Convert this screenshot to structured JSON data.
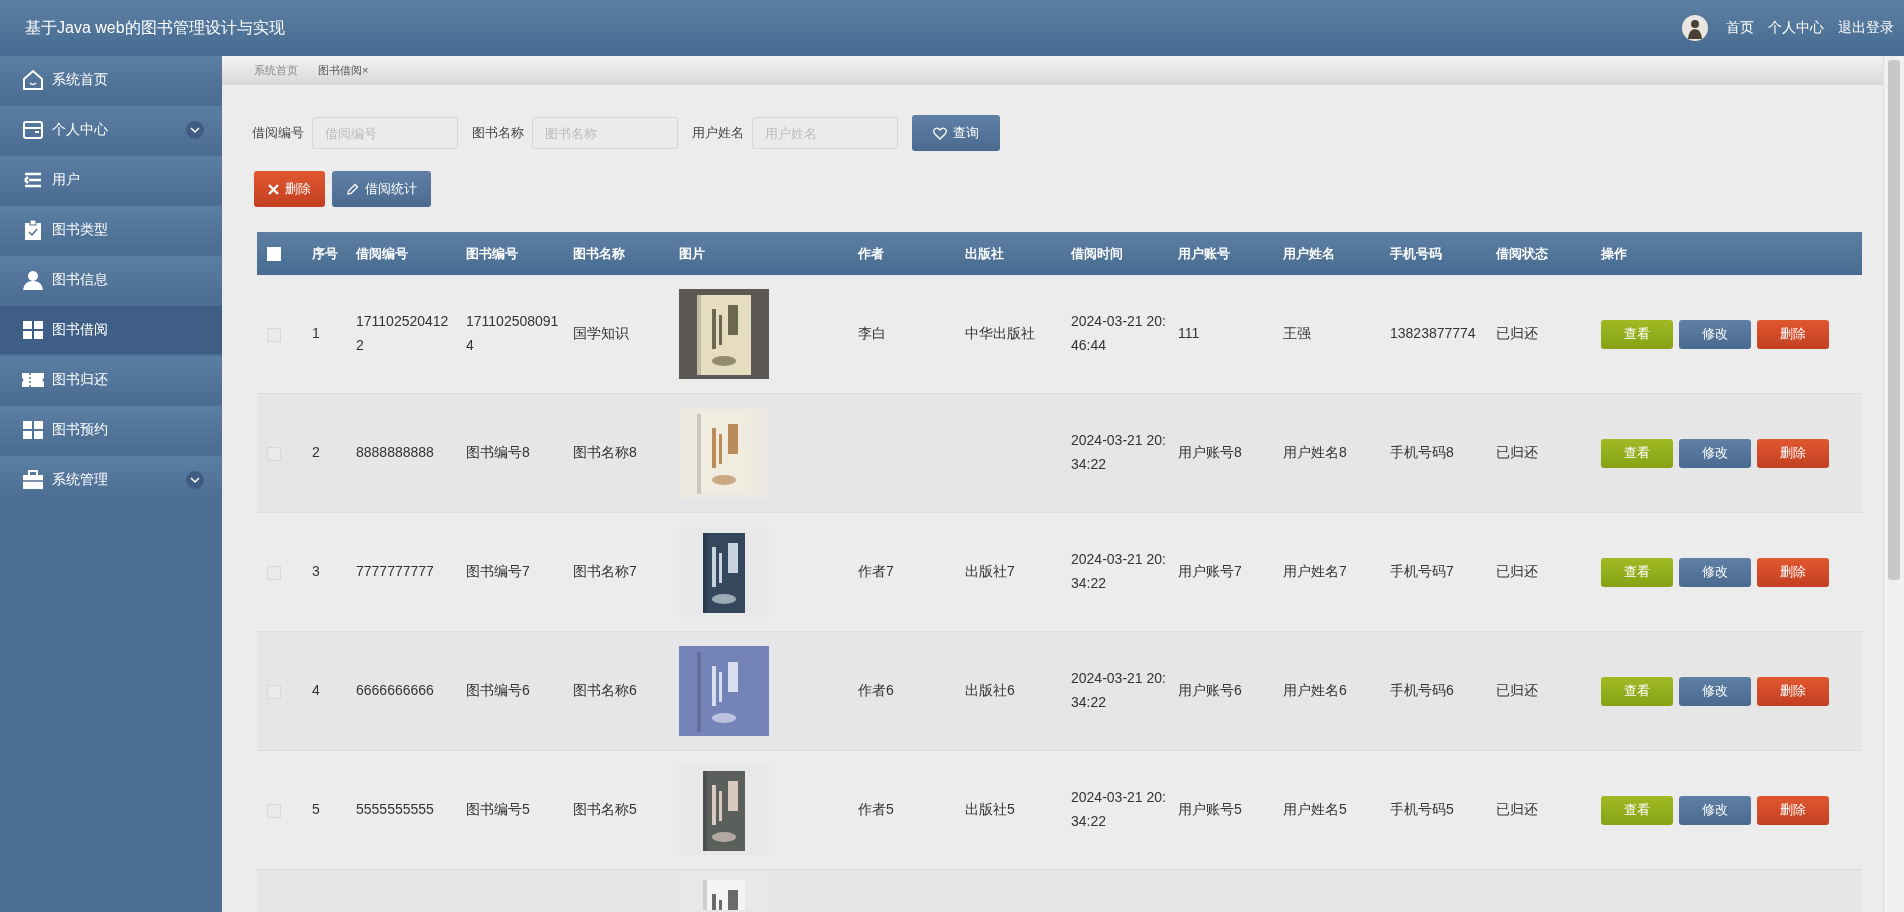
{
  "header": {
    "title": "基于Java web的图书管理设计与实现",
    "links": [
      "首页",
      "个人中心",
      "退出登录"
    ]
  },
  "sidebar": {
    "items": [
      {
        "label": "系统首页",
        "selected": false
      },
      {
        "label": "个人中心",
        "selected": false,
        "expanded": false
      },
      {
        "label": "用户",
        "selected": false
      },
      {
        "label": "图书类型",
        "selected": false
      },
      {
        "label": "图书信息",
        "selected": false
      },
      {
        "label": "图书借阅",
        "selected": true
      },
      {
        "label": "图书归还",
        "selected": false
      },
      {
        "label": "图书预约",
        "selected": false
      },
      {
        "label": "系统管理",
        "selected": false,
        "expanded": false
      }
    ]
  },
  "breadcrumb_tabs": [
    {
      "label": "系统首页",
      "selected": false
    },
    {
      "label": "图书借阅",
      "close": "×",
      "selected": true
    }
  ],
  "search": {
    "fields": [
      {
        "label": "借阅编号",
        "placeholder": "借阅编号"
      },
      {
        "label": "图书名称",
        "placeholder": "图书名称"
      },
      {
        "label": "用户姓名",
        "placeholder": "用户姓名"
      }
    ],
    "button": "查询"
  },
  "toolbar": [
    {
      "label": "删除",
      "kind": "delete"
    },
    {
      "label": "借阅统计",
      "kind": "stats"
    }
  ],
  "table": {
    "select_all": {
      "checked": false
    },
    "columns": [
      "序号",
      "借阅编号",
      "图书编号",
      "图书名称",
      "图片",
      "作者",
      "出版社",
      "借阅时间",
      "用户账号",
      "用户姓名",
      "手机号码",
      "借阅状态",
      "操作"
    ],
    "rows": [
      {
        "checked": false,
        "cells": [
          "1",
          "1711025204122",
          "1711025080914",
          "国学知识"
        ],
        "picture": {
          "kind": "picture"
        },
        "author": "李白",
        "publisher": "中华出版社",
        "after": [
          "2024-03-21 20:46:44",
          "111",
          "王强",
          "13823877774",
          "已归还"
        ],
        "actions": [
          {
            "label": "查看",
            "kind": "view"
          },
          {
            "label": "修改",
            "kind": "edit"
          },
          {
            "label": "删除",
            "kind": "delete"
          }
        ]
      },
      {
        "checked": false,
        "cells": [
          "2",
          "8888888888",
          "图书编号8",
          "图书名称8"
        ],
        "picture": {
          "kind": "picture"
        },
        "after": [
          "2024-03-21 20:34:22",
          "用户账号8",
          "用户姓名8",
          "手机号码8",
          "已归还"
        ],
        "actions": [
          {
            "label": "查看",
            "kind": "view"
          },
          {
            "label": "修改",
            "kind": "edit"
          },
          {
            "label": "删除",
            "kind": "delete"
          }
        ]
      },
      {
        "checked": false,
        "cells": [
          "3",
          "7777777777",
          "图书编号7",
          "图书名称7"
        ],
        "picture": {
          "kind": "picture"
        },
        "author": "作者7",
        "publisher": "出版社7",
        "after": [
          "2024-03-21 20:34:22",
          "用户账号7",
          "用户姓名7",
          "手机号码7",
          "已归还"
        ],
        "actions": [
          {
            "label": "查看",
            "kind": "view"
          },
          {
            "label": "修改",
            "kind": "edit"
          },
          {
            "label": "删除",
            "kind": "delete"
          }
        ]
      },
      {
        "checked": false,
        "cells": [
          "4",
          "6666666666",
          "图书编号6",
          "图书名称6"
        ],
        "picture": {
          "kind": "picture"
        },
        "author": "作者6",
        "publisher": "出版社6",
        "after": [
          "2024-03-21 20:34:22",
          "用户账号6",
          "用户姓名6",
          "手机号码6",
          "已归还"
        ],
        "actions": [
          {
            "label": "查看",
            "kind": "view"
          },
          {
            "label": "修改",
            "kind": "edit"
          },
          {
            "label": "删除",
            "kind": "delete"
          }
        ]
      },
      {
        "checked": false,
        "cells": [
          "5",
          "5555555555",
          "图书编号5",
          "图书名称5"
        ],
        "picture": {
          "kind": "picture"
        },
        "author": "作者5",
        "publisher": "出版社5",
        "after": [
          "2024-03-21 20:34:22",
          "用户账号5",
          "用户姓名5",
          "手机号码5",
          "已归还"
        ],
        "actions": [
          {
            "label": "查看",
            "kind": "view"
          },
          {
            "label": "修改",
            "kind": "edit"
          },
          {
            "label": "删除",
            "kind": "delete"
          }
        ]
      },
      {
        "picture": {
          "kind": "picture"
        }
      }
    ]
  }
}
